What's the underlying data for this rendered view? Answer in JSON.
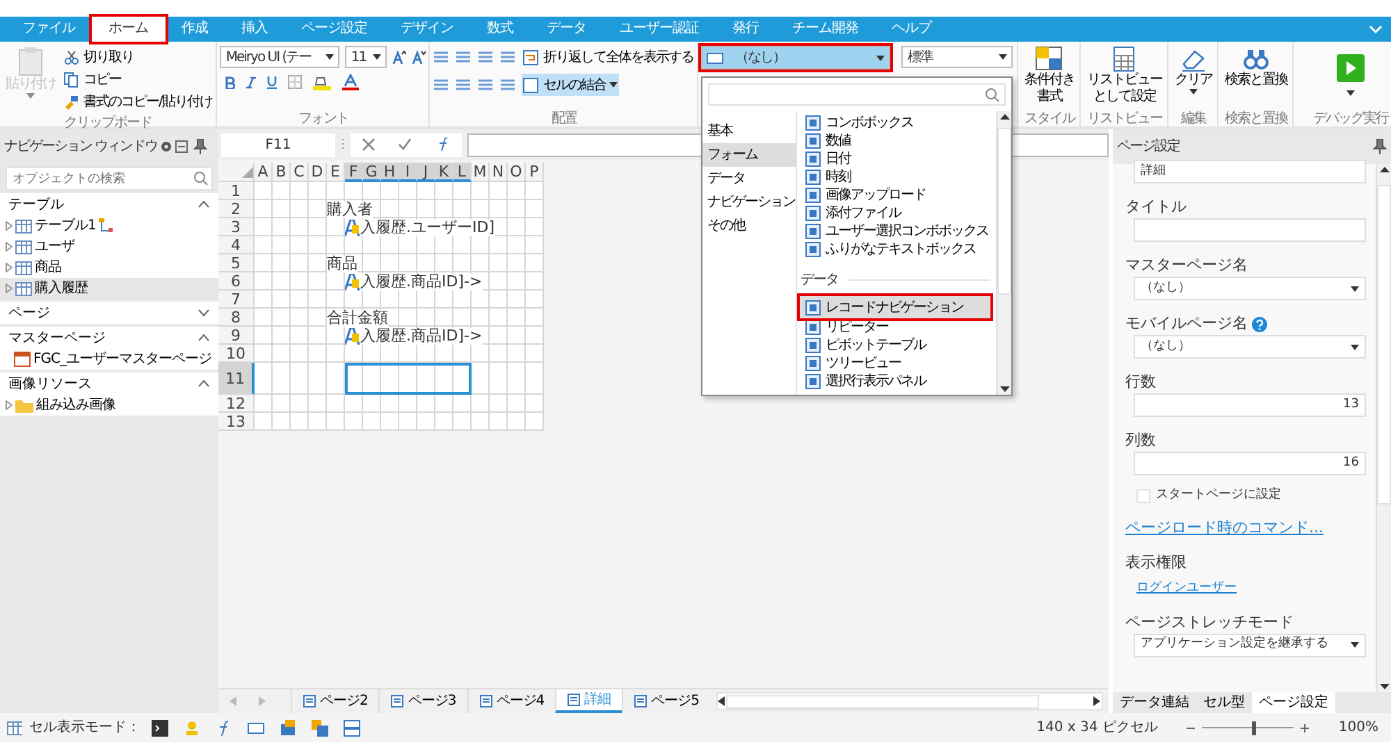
{
  "tabs": [
    {
      "label": "ファイル",
      "selected": false,
      "highlighted": false
    },
    {
      "label": "ホーム",
      "selected": true,
      "highlighted": true
    },
    {
      "label": "作成",
      "selected": false,
      "highlighted": false
    },
    {
      "label": "挿入",
      "selected": false,
      "highlighted": false
    },
    {
      "label": "ページ設定",
      "selected": false,
      "highlighted": false
    },
    {
      "label": "デザイン",
      "selected": false,
      "highlighted": false
    },
    {
      "label": "数式",
      "selected": false,
      "highlighted": false
    },
    {
      "label": "データ",
      "selected": false,
      "highlighted": false
    },
    {
      "label": "ユーザー認証",
      "selected": false,
      "highlighted": false
    },
    {
      "label": "発行",
      "selected": false,
      "highlighted": false
    },
    {
      "label": "チーム開発",
      "selected": false,
      "highlighted": false
    },
    {
      "label": "ヘルプ",
      "selected": false,
      "highlighted": false
    }
  ],
  "ribbon": [
    {
      "kind": "clipboard",
      "label": "クリップボード",
      "paste": {
        "label": "貼り付け",
        "disabled": true
      },
      "buttons": [
        "切り取り",
        "コピー",
        "書式のコピー/貼り付け"
      ]
    },
    {
      "kind": "font",
      "label": "フォント",
      "font_name": "Meiryo UI (テー",
      "font_size": "11"
    },
    {
      "kind": "align",
      "label": "配置",
      "wrap": "折り返して全体を表示する",
      "merge": {
        "label": "セルの結合",
        "on": true
      }
    },
    {
      "kind": "celltype",
      "cell_type": {
        "value": "（なし）",
        "highlighted": true
      },
      "format": "標準"
    },
    {
      "kind": "big",
      "label": "スタイル",
      "lines": [
        "条件付き",
        "書式"
      ]
    },
    {
      "kind": "big",
      "label": "リストビュー",
      "lines": [
        "リストビュー",
        "として設定"
      ]
    },
    {
      "kind": "big",
      "label": "編集",
      "lines": [
        "クリア"
      ]
    },
    {
      "kind": "big",
      "label": "検索と置換",
      "lines": [
        "検索と置換"
      ]
    },
    {
      "kind": "debug",
      "label": "デバッグ実行"
    }
  ],
  "navigation": {
    "title": "ナビゲーション ウィンドウ",
    "search": {
      "placeholder": "オブジェクトの検索"
    },
    "sections": [
      {
        "title": "テーブル",
        "expanded": true,
        "items": [
          {
            "label": "テーブル1",
            "selected": false
          },
          {
            "label": "ユーザ",
            "selected": false
          },
          {
            "label": "商品",
            "selected": false
          },
          {
            "label": "購入履歴",
            "selected": true
          }
        ]
      },
      {
        "title": "ページ",
        "expanded": false
      },
      {
        "title": "マスターページ",
        "expanded": true,
        "items": [
          {
            "label": "FGC_ユーザーマスターページ",
            "selected": false
          }
        ]
      },
      {
        "title": "画像リソース",
        "expanded": true,
        "items": [
          {
            "label": "組み込み画像",
            "selected": false
          }
        ]
      }
    ]
  },
  "formula_bar": {
    "name_box": "F11"
  },
  "sheet": {
    "columns": [
      {
        "label": "A",
        "selected": false
      },
      {
        "label": "B",
        "selected": false
      },
      {
        "label": "C",
        "selected": false
      },
      {
        "label": "D",
        "selected": false
      },
      {
        "label": "E",
        "selected": false
      },
      {
        "label": "F",
        "selected": true
      },
      {
        "label": "G",
        "selected": true
      },
      {
        "label": "H",
        "selected": true
      },
      {
        "label": "I",
        "selected": true
      },
      {
        "label": "J",
        "selected": true
      },
      {
        "label": "K",
        "selected": true
      },
      {
        "label": "L",
        "selected": true
      },
      {
        "label": "M",
        "selected": false
      },
      {
        "label": "N",
        "selected": false
      },
      {
        "label": "O",
        "selected": false
      },
      {
        "label": "P",
        "selected": false
      }
    ],
    "rows": [
      {
        "label": "1",
        "selected": false
      },
      {
        "label": "2",
        "selected": false,
        "cell": {
          "kind": "label",
          "text": "購入者"
        }
      },
      {
        "label": "3",
        "selected": false,
        "cell": {
          "kind": "field",
          "text": "入履歴.ユーザーID]"
        }
      },
      {
        "label": "4",
        "selected": false
      },
      {
        "label": "5",
        "selected": false,
        "cell": {
          "kind": "label",
          "text": "商品"
        }
      },
      {
        "label": "6",
        "selected": false,
        "cell": {
          "kind": "field",
          "text": "入履歴.商品ID]->"
        }
      },
      {
        "label": "7",
        "selected": false
      },
      {
        "label": "8",
        "selected": false,
        "cell": {
          "kind": "label",
          "text": "合計金額"
        }
      },
      {
        "label": "9",
        "selected": false,
        "cell": {
          "kind": "field",
          "text": "入履歴.商品ID]->"
        }
      },
      {
        "label": "10",
        "selected": false
      },
      {
        "label": "11",
        "selected": true
      },
      {
        "label": "12",
        "selected": false
      },
      {
        "label": "13",
        "selected": false
      }
    ],
    "tabs": [
      {
        "label": "ページ2",
        "selected": false
      },
      {
        "label": "ページ3",
        "selected": false
      },
      {
        "label": "ページ4",
        "selected": false
      },
      {
        "label": "詳細",
        "selected": true
      },
      {
        "label": "ページ5",
        "selected": false
      }
    ]
  },
  "cell_type_dropdown": {
    "categories": [
      {
        "label": "基本",
        "selected": false
      },
      {
        "label": "フォーム",
        "selected": true
      },
      {
        "label": "データ",
        "selected": false
      },
      {
        "label": "ナビゲーション",
        "selected": false
      },
      {
        "label": "その他",
        "selected": false
      }
    ],
    "groups": [
      {
        "items": [
          {
            "label": "コンボボックス",
            "selected": false,
            "highlighted": false
          },
          {
            "label": "数値",
            "selected": false,
            "highlighted": false
          },
          {
            "label": "日付",
            "selected": false,
            "highlighted": false
          },
          {
            "label": "時刻",
            "selected": false,
            "highlighted": false
          },
          {
            "label": "画像アップロード",
            "selected": false,
            "highlighted": false
          },
          {
            "label": "添付ファイル",
            "selected": false,
            "highlighted": false
          },
          {
            "label": "ユーザー選択コンボボックス",
            "selected": false,
            "highlighted": false
          },
          {
            "label": "ふりがなテキストボックス",
            "selected": false,
            "highlighted": false
          }
        ]
      },
      {
        "title": "データ",
        "items": [
          {
            "label": "レコードナビゲーション",
            "selected": true,
            "highlighted": true
          },
          {
            "label": "リピーター",
            "selected": false,
            "highlighted": false
          },
          {
            "label": "ピボットテーブル",
            "selected": false,
            "highlighted": false
          },
          {
            "label": "ツリービュー",
            "selected": false,
            "highlighted": false
          },
          {
            "label": "選択行表示パネル",
            "selected": false,
            "highlighted": false
          }
        ]
      }
    ]
  },
  "properties": {
    "title": "ページ設定",
    "fields": [
      {
        "kind": "input",
        "value": "詳細"
      },
      {
        "kind": "input",
        "label": "タイトル"
      },
      {
        "kind": "select",
        "label": "マスターページ名",
        "value": "（なし）"
      },
      {
        "kind": "select",
        "label": "モバイルページ名",
        "help": true,
        "value": "（なし）"
      },
      {
        "kind": "number",
        "label": "行数",
        "value": "13"
      },
      {
        "kind": "number",
        "label": "列数",
        "value": "16"
      },
      {
        "kind": "checkbox",
        "label": "スタートページに設定",
        "checked": false
      },
      {
        "kind": "command",
        "label": "ページロード時のコマンド..."
      },
      {
        "kind": "link",
        "label": "表示権限",
        "value": "ログインユーザー"
      },
      {
        "kind": "select",
        "label": "ページストレッチモード",
        "value": "アプリケーション設定を継承する"
      }
    ],
    "tabs": [
      {
        "label": "データ連結",
        "selected": false
      },
      {
        "label": "セル型",
        "selected": false
      },
      {
        "label": "ページ設定",
        "selected": true
      }
    ]
  },
  "status_bar": {
    "mode_label": "セル表示モード：",
    "size": "140 x 34 ピクセル",
    "zoom": {
      "level": 0.55,
      "value": "100%"
    }
  }
}
